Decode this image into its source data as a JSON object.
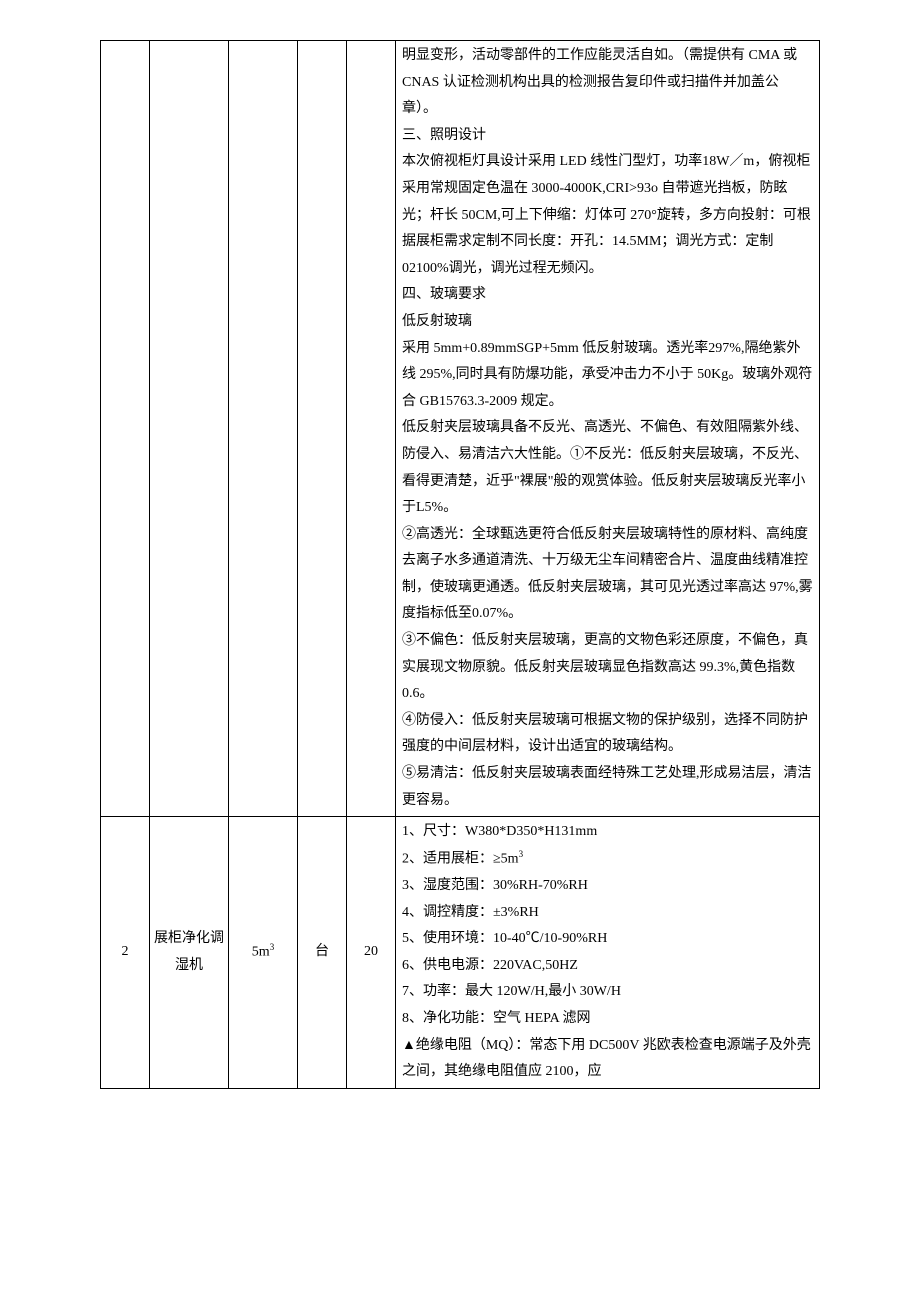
{
  "rows": [
    {
      "c1": "",
      "c2": "",
      "c3": "",
      "c4": "",
      "c5": "",
      "c6": "明显变形，活动零部件的工作应能灵活自如。（需提供有 CMA 或 CNAS 认证检测机构出具的检测报告复印件或扫描件并加盖公章）。\n三、照明设计\n本次俯视柜灯具设计采用 LED 线性门型灯，功率18W／m，俯视柜采用常规固定色温在 3000-4000K,CRI>93o 自带遮光挡板，防眩光；杆长 50CM,可上下伸缩：灯体可 270°旋转，多方向投射：可根据展柜需求定制不同长度：开孔：14.5MM；调光方式：定制 02100%调光，调光过程无频闪。\n四、玻璃要求\n低反射玻璃\n采用 5mm+0.89mmSGP+5mm 低反射玻璃。透光率297%,隔绝紫外线 295%,同时具有防爆功能，承受冲击力不小于 50Kg。玻璃外观符合 GB15763.3-2009 规定。\n低反射夹层玻璃具备不反光、高透光、不偏色、有效阻隔紫外线、防侵入、易清洁六大性能。①不反光：低反射夹层玻璃，不反光、看得更清楚，近乎\"裸展\"般的观赏体验。低反射夹层玻璃反光率小于L5%。\n②高透光：全球甄选更符合低反射夹层玻璃特性的原材料、高纯度去离子水多通道清洗、十万级无尘车间精密合片、温度曲线精准控制，使玻璃更通透。低反射夹层玻璃，其可见光透过率高达 97%,雾度指标低至0.07%。\n③不偏色：低反射夹层玻璃，更高的文物色彩还原度，不偏色，真实展现文物原貌。低反射夹层玻璃显色指数高达 99.3%,黄色指数 0.6。\n④防侵入：低反射夹层玻璃可根据文物的保护级别，选择不同防护强度的中间层材料，设计出适宜的玻璃结构。\n⑤易清洁：低反射夹层玻璃表面经特殊工艺处理,形成易洁层，清洁更容易。"
    },
    {
      "c1": "2",
      "c2": "展柜净化调湿机",
      "c3": "5m³",
      "c4": "台",
      "c5": "20",
      "c6": "1、尺寸：W380*D350*H131mm\n2、适用展柜：≥5m³\n3、湿度范围：30%RH-70%RH\n4、调控精度：±3%RH\n5、使用环境：10-40℃/10-90%RH\n6、供电电源：220VAC,50HZ\n7、功率：最大 120W/H,最小 30W/H\n8、净化功能：空气 HEPA 滤网\n▲绝缘电阻（MQ）：常态下用 DC500V 兆欧表检查电源端子及外壳之间，其绝缘电阻值应 2100，应"
    }
  ]
}
